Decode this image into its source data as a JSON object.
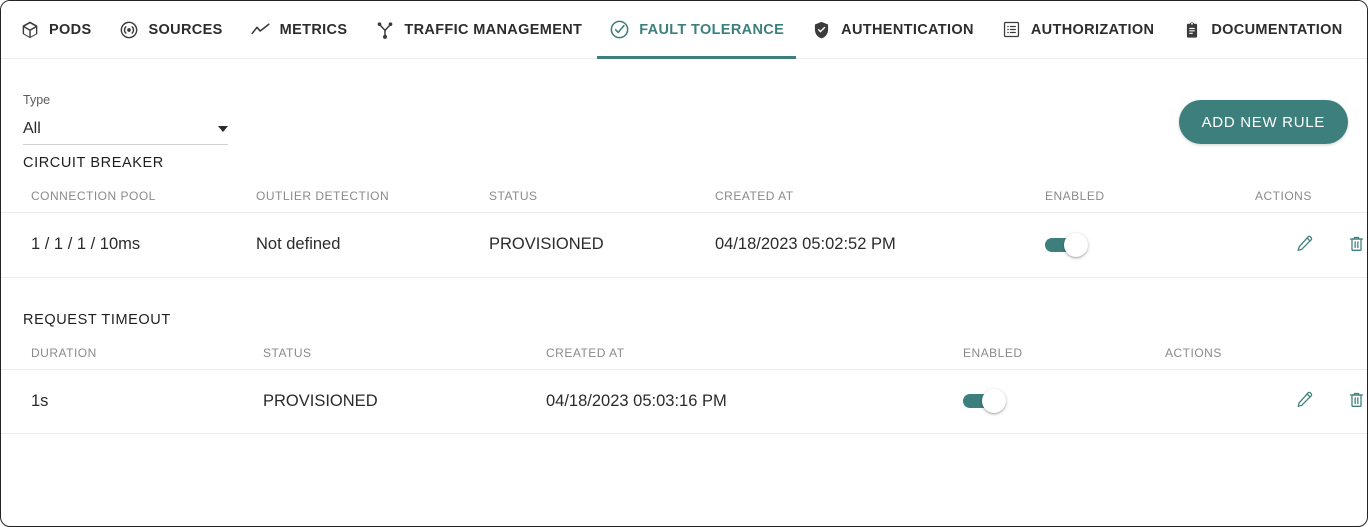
{
  "tabs": [
    {
      "label": "PODS",
      "icon": "cube-icon",
      "active": false
    },
    {
      "label": "SOURCES",
      "icon": "broadcast-icon",
      "active": false
    },
    {
      "label": "METRICS",
      "icon": "line-chart-icon",
      "active": false
    },
    {
      "label": "TRAFFIC MANAGEMENT",
      "icon": "branch-icon",
      "active": false
    },
    {
      "label": "FAULT TOLERANCE",
      "icon": "check-circle-icon",
      "active": true
    },
    {
      "label": "AUTHENTICATION",
      "icon": "shield-check-icon",
      "active": false
    },
    {
      "label": "AUTHORIZATION",
      "icon": "list-box-icon",
      "active": false
    },
    {
      "label": "DOCUMENTATION",
      "icon": "clipboard-icon",
      "active": false
    }
  ],
  "filter": {
    "type_label": "Type",
    "type_value": "All",
    "caret_icon": "chevron-down-icon"
  },
  "toolbar": {
    "add_rule_label": "ADD NEW RULE"
  },
  "sections": {
    "circuit_breaker": {
      "title": "CIRCUIT BREAKER",
      "columns": [
        "CONNECTION POOL",
        "OUTLIER DETECTION",
        "STATUS",
        "CREATED AT",
        "ENABLED",
        "ACTIONS"
      ],
      "rows": [
        {
          "connection_pool": "1 / 1 / 1 / 10ms",
          "outlier_detection": "Not defined",
          "status": "PROVISIONED",
          "created_at": "04/18/2023 05:02:52 PM",
          "enabled": true,
          "edit_icon": "pencil-icon",
          "delete_icon": "trash-icon"
        }
      ]
    },
    "request_timeout": {
      "title": "REQUEST TIMEOUT",
      "columns": [
        "DURATION",
        "STATUS",
        "CREATED AT",
        "ENABLED",
        "ACTIONS"
      ],
      "rows": [
        {
          "duration": "1s",
          "status": "PROVISIONED",
          "created_at": "04/18/2023 05:03:16 PM",
          "enabled": true,
          "edit_icon": "pencil-icon",
          "delete_icon": "trash-icon"
        }
      ]
    }
  },
  "colors": {
    "accent_teal": "#3d7f7d",
    "text_primary": "#2b2b2b",
    "text_muted": "#8a8a8a",
    "text_disabled": "#bdbdbd",
    "divider": "#ececec"
  }
}
